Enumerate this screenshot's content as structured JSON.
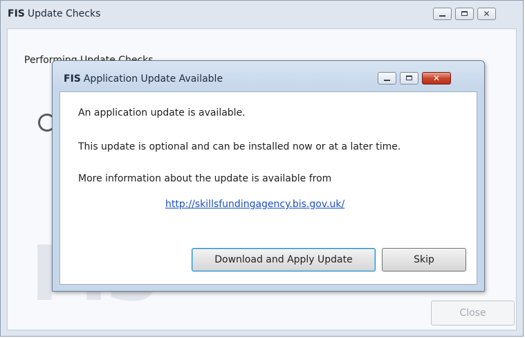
{
  "outer_window": {
    "brand": "FIS",
    "title": "Update Checks",
    "progress_text": "Performing Update Checks",
    "watermark": "FIS",
    "close_label": "Close"
  },
  "dialog": {
    "brand": "FIS",
    "title": "Application Update Available",
    "line1": "An application update is available.",
    "line2": "This update is optional and can be installed now or at a later time.",
    "line3": "More information about the update is available from",
    "link": "http://skillsfundingagency.bis.gov.uk/",
    "download_label": "Download and Apply Update",
    "skip_label": "Skip"
  },
  "caption_icons": [
    "minimize-icon",
    "maximize-icon",
    "close-icon"
  ],
  "colors": {
    "link": "#1a4ec4",
    "close_button_red": "#c9462c",
    "default_button_border": "#3c7fb1"
  }
}
